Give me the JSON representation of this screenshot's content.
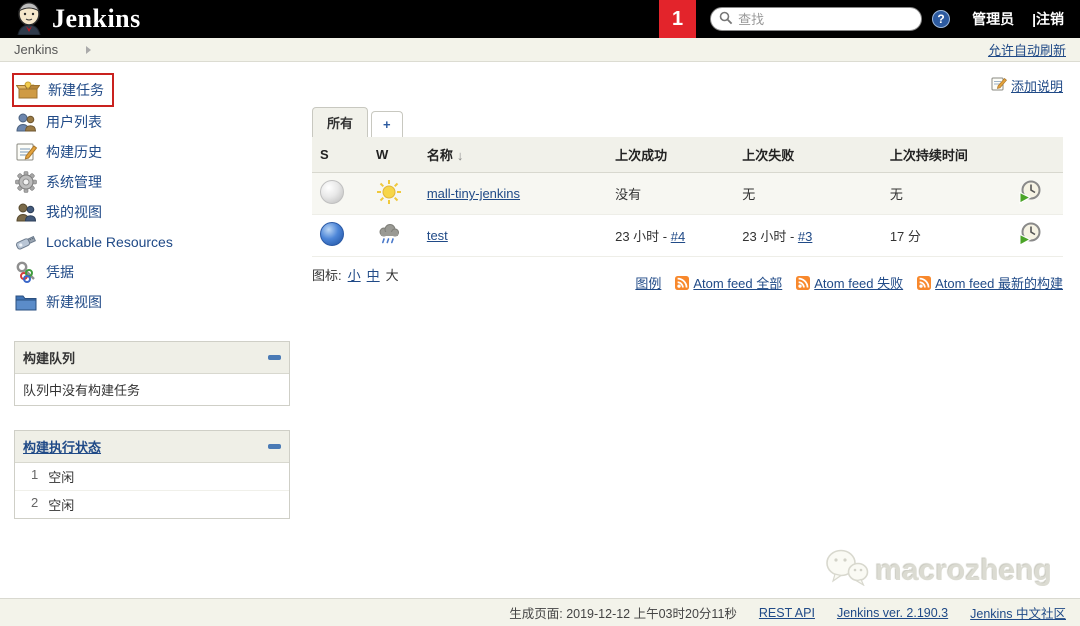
{
  "colors": {
    "accent_red": "#e3242b",
    "annotation_red": "#c9211e",
    "link_blue": "#204a87",
    "rss_orange": "#f8882c",
    "header_black": "#000000",
    "bar_beige": "#f3f3ea"
  },
  "header": {
    "logo_text": "Jenkins",
    "step_badge": "1",
    "search_placeholder": "查找",
    "help_glyph": "?",
    "admin_label": "管理员",
    "logout_label": "|注销"
  },
  "breadcrumb": {
    "root": "Jenkins",
    "auto_refresh": "允许自动刷新"
  },
  "sidebar": {
    "items": [
      {
        "label": "新建任务",
        "icon": "new-item-icon",
        "highlighted": true
      },
      {
        "label": "用户列表",
        "icon": "people-icon"
      },
      {
        "label": "构建历史",
        "icon": "build-history-icon"
      },
      {
        "label": "系统管理",
        "icon": "gear-icon"
      },
      {
        "label": "我的视图",
        "icon": "my-views-icon"
      },
      {
        "label": "Lockable Resources",
        "icon": "lockable-resources-icon"
      },
      {
        "label": "凭据",
        "icon": "credentials-icon"
      },
      {
        "label": "新建视图",
        "icon": "new-view-icon"
      }
    ],
    "build_queue": {
      "title": "构建队列",
      "empty_text": "队列中没有构建任务"
    },
    "executor_status": {
      "title": "构建执行状态",
      "executors": [
        {
          "num": "1",
          "status": "空闲"
        },
        {
          "num": "2",
          "status": "空闲"
        }
      ]
    }
  },
  "main": {
    "add_description": "添加说明",
    "tabs": [
      {
        "label": "所有",
        "active": true
      },
      {
        "label": "+",
        "active": false
      }
    ],
    "table": {
      "headers": {
        "s": "S",
        "w": "W",
        "name": "名称",
        "last_success": "上次成功",
        "last_failure": "上次失败",
        "last_duration": "上次持续时间"
      },
      "sort_arrow": "↓",
      "rows": [
        {
          "status": "not-built",
          "weather": "sunny",
          "name": "mall-tiny-jenkins",
          "last_success": "没有",
          "last_failure": "无",
          "last_duration": "无"
        },
        {
          "status": "success",
          "weather": "rainy",
          "name": "test",
          "last_success_time": "23 小时 - ",
          "last_success_build": "#4",
          "last_failure_time": "23 小时 - ",
          "last_failure_build": "#3",
          "last_duration": "17 分"
        }
      ]
    },
    "icon_size": {
      "label": "图标:",
      "small": "小",
      "medium": "中",
      "large": "大"
    },
    "feeds": {
      "legend": "图例",
      "all": "Atom feed 全部",
      "failures": "Atom feed 失败",
      "latest": "Atom feed 最新的构建"
    }
  },
  "watermark": "macrozheng",
  "footer": {
    "generated": "生成页面: 2019-12-12 上午03时20分11秒",
    "links": [
      "REST API",
      "Jenkins ver. 2.190.3",
      "Jenkins 中文社区"
    ]
  }
}
